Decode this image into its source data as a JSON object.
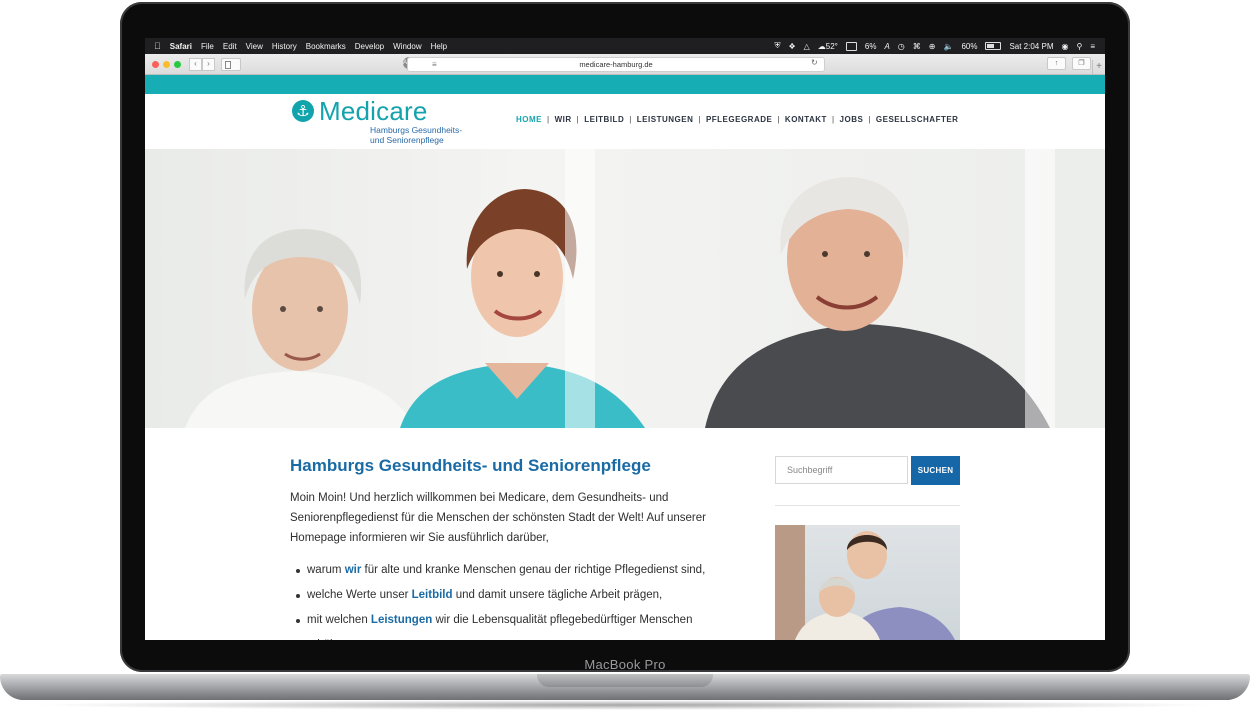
{
  "menubar": {
    "app": "Safari",
    "items": [
      "File",
      "Edit",
      "View",
      "History",
      "Bookmarks",
      "Develop",
      "Window",
      "Help"
    ],
    "temperature": "52°",
    "cpu": "6%",
    "battery": "60%",
    "clock": "Sat 2:04 PM"
  },
  "browser": {
    "url": "medicare-hamburg.de",
    "address_badge": "ABP"
  },
  "site": {
    "logo_name": "Medicare",
    "logo_tagline_1": "Hamburgs Gesundheits-",
    "logo_tagline_2": "und Seniorenpflege",
    "nav": [
      "HOME",
      "WIR",
      "LEITBILD",
      "LEISTUNGEN",
      "PFLEGEGRADE",
      "KONTAKT",
      "JOBS",
      "GESELLSCHAFTER"
    ],
    "nav_active": "HOME",
    "colors": {
      "teal": "#16adb4",
      "blue": "#1667a8"
    }
  },
  "main": {
    "title": "Hamburgs Gesundheits- und Seniorenpflege",
    "intro": "Moin Moin! Und herzlich willkommen bei Medicare, dem Gesundheits- und Seniorenpflegedienst für die Menschen der schönsten Stadt der Welt! Auf unserer Homepage informieren wir Sie ausführlich darüber,",
    "bullets": [
      {
        "pre": "warum ",
        "link": "wir",
        "post": " für alte und kranke Menschen genau der richtige Pflegedienst sind,"
      },
      {
        "pre": "welche Werte unser ",
        "link": "Leitbild",
        "post": " und damit unsere tägliche Arbeit prägen,"
      },
      {
        "pre": "mit welchen ",
        "link": "Leistungen",
        "post": " wir die Lebensqualität pflegebedürftiger Menschen erhöhen,"
      }
    ]
  },
  "sidebar": {
    "search_placeholder": "Suchbegriff",
    "search_button": "SUCHEN"
  },
  "device": {
    "label": "MacBook Pro"
  }
}
